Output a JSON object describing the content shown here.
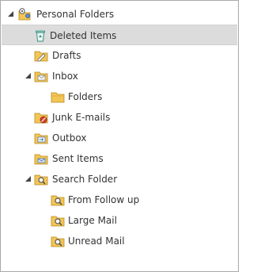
{
  "tree": {
    "items": [
      {
        "label": "Personal Folders",
        "icon": "personal-folders-icon",
        "expanded": true
      },
      {
        "label": "Deleted Items",
        "icon": "recycle-bin-icon",
        "selected": true
      },
      {
        "label": "Drafts",
        "icon": "drafts-folder-icon"
      },
      {
        "label": "Inbox",
        "icon": "inbox-folder-icon",
        "expanded": true
      },
      {
        "label": "Folders",
        "icon": "folder-icon"
      },
      {
        "label": "Junk E-mails",
        "icon": "junk-folder-icon"
      },
      {
        "label": "Outbox",
        "icon": "outbox-folder-icon"
      },
      {
        "label": "Sent Items",
        "icon": "sent-folder-icon"
      },
      {
        "label": "Search Folder",
        "icon": "search-folder-icon",
        "expanded": true
      },
      {
        "label": "From Follow up",
        "icon": "search-folder-icon"
      },
      {
        "label": "Large Mail",
        "icon": "search-folder-icon"
      },
      {
        "label": "Unread Mail",
        "icon": "search-folder-icon"
      }
    ]
  },
  "colors": {
    "selection": "#dcdcdc",
    "folder": "#f3c554",
    "border": "#a9a9a9"
  }
}
